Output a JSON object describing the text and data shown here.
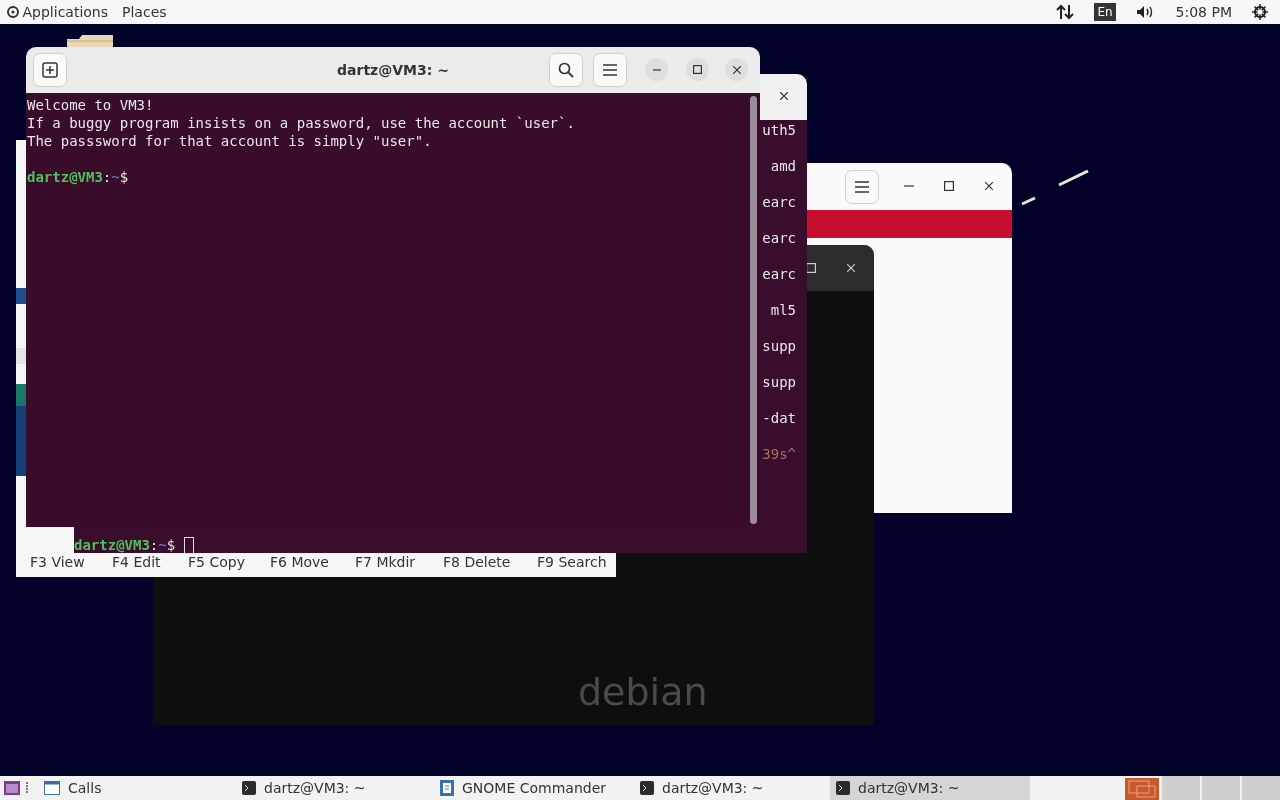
{
  "top_panel": {
    "menus": [
      "Applications",
      "Places"
    ],
    "keyboard": "En",
    "clock": "5:08 PM"
  },
  "debian_window": {
    "logo_text": "debian"
  },
  "commander": {
    "function_keys": [
      "F3 View",
      "F4 Edit",
      "F5 Copy",
      "F6 Move",
      "F7 Mkdir",
      "F8 Delete",
      "F9 Search"
    ]
  },
  "back_terminal": {
    "fragments": [
      {
        "text": "uth5",
        "faded": false
      },
      {
        "text": "amd",
        "faded": false
      },
      {
        "text": "earc",
        "faded": false
      },
      {
        "text": "earc",
        "faded": false
      },
      {
        "text": "earc",
        "faded": false
      },
      {
        "text": "ml5",
        "faded": false
      },
      {
        "text": "supp",
        "faded": false
      },
      {
        "text": "supp",
        "faded": false
      },
      {
        "text": "-dat",
        "faded": false
      },
      {
        "text": "39s^",
        "faded": true
      }
    ],
    "prompt": {
      "user_host": "dartz@VM3",
      "separator": ":",
      "path": "~",
      "symbol": "$"
    }
  },
  "main_terminal": {
    "title": "dartz@VM3: ~",
    "lines": [
      "Welcome to VM3!",
      "If a buggy program insists on a password, use the account `user`.",
      "The passsword for that account is simply \"user\"."
    ],
    "prompt": {
      "user_host": "dartz@VM3",
      "separator": ":",
      "path": "~",
      "symbol": "$"
    }
  },
  "taskbar": {
    "items": [
      {
        "label": "Calls",
        "kind": "window",
        "selected": false
      },
      {
        "label": "dartz@VM3: ~",
        "kind": "terminal",
        "selected": false
      },
      {
        "label": "GNOME Commander",
        "kind": "commander",
        "selected": false
      },
      {
        "label": "dartz@VM3: ~",
        "kind": "terminal",
        "selected": false
      },
      {
        "label": "dartz@VM3: ~",
        "kind": "terminal",
        "selected": true
      }
    ]
  }
}
